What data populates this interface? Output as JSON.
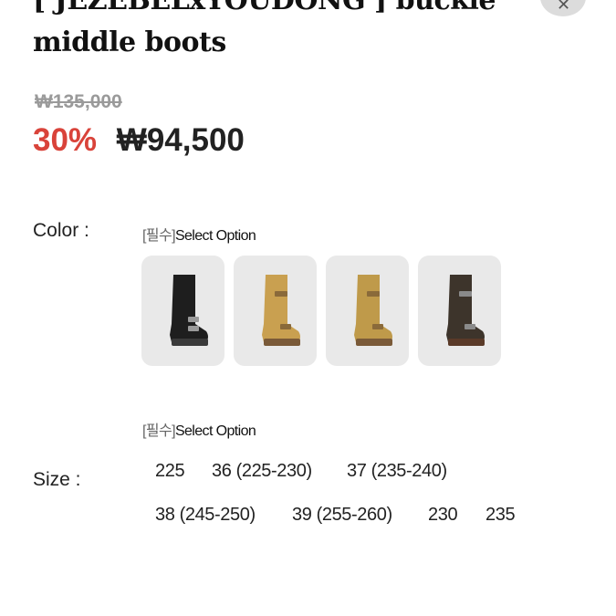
{
  "product": {
    "title_line1": "[ JEZEBELxYOUDONG ] buckle",
    "title_line2": "middle boots",
    "original_price": "₩135,000",
    "discount": "30%",
    "sale_price": "₩94,500"
  },
  "close_icon": "close-icon",
  "color": {
    "label": "Color :",
    "required_tag": "[필수]",
    "hint": "Select Option",
    "swatches": [
      {
        "name": "black",
        "boot_color": "#1e1e1e",
        "sole_color": "#3a3a3a"
      },
      {
        "name": "tan",
        "boot_color": "#c9a050",
        "sole_color": "#7a5a38"
      },
      {
        "name": "camel",
        "boot_color": "#bf9a4a",
        "sole_color": "#7a5a38"
      },
      {
        "name": "brown",
        "boot_color": "#3d342b",
        "sole_color": "#5a3a28"
      }
    ]
  },
  "size": {
    "label": "Size :",
    "required_tag": "[필수]",
    "hint": "Select Option",
    "row1": [
      "225",
      "36 (225-230)",
      "37 (235-240)"
    ],
    "row2": [
      "38 (245-250)",
      "39 (255-260)",
      "230",
      "235"
    ]
  }
}
